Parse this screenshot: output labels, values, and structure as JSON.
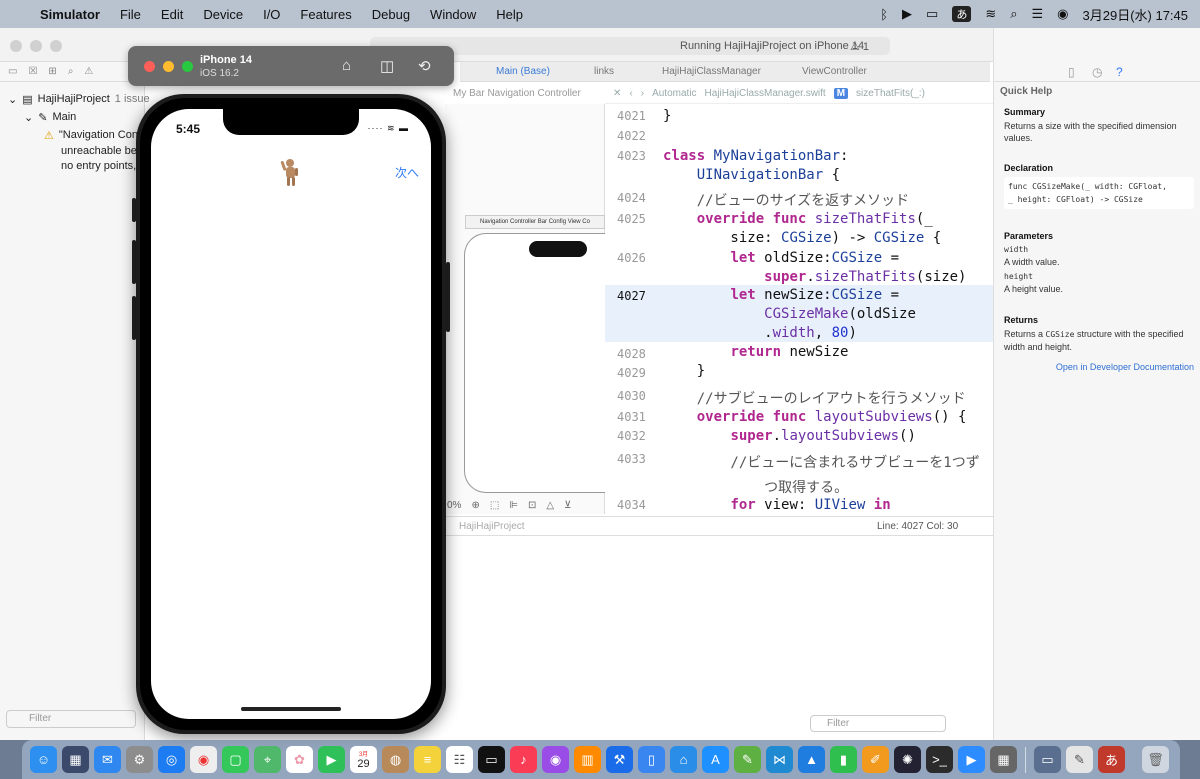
{
  "menubar": {
    "app": "Simulator",
    "items": [
      "File",
      "Edit",
      "Device",
      "I/O",
      "Features",
      "Debug",
      "Window",
      "Help"
    ],
    "ime": "あ",
    "datetime": "3月29日(水) 17:45"
  },
  "xcode": {
    "project_tab": "HajiHajiProject",
    "run_status": "Running HajiHajiProject on iPhone 14",
    "issue_count": "1",
    "navigator": {
      "project": "HajiHajiProject",
      "issue_label": "1 issue",
      "group": "Main",
      "issue_lines": [
        "\"Navigation Con",
        "unreachable bec",
        "no entry points,"
      ],
      "filter_placeholder": "Filter"
    },
    "editor_tabs": [
      "Main (Base)",
      "links",
      "HajiHajiClassManager",
      "ViewController"
    ],
    "storyboard_breadcrumb": "My Bar Navigation Controller",
    "jumpbar": {
      "mode": "Automatic",
      "file": "HajiHajiClassManager.swift",
      "symbol_badge": "M",
      "symbol": "sizeThatFits(_:)"
    },
    "scene_title": "Navigation Controller Bar Config View Co",
    "zoom": "0%",
    "status": {
      "project": "HajiHajiProject",
      "position": "Line: 4027  Col: 30"
    },
    "debug_filter_placeholder": "Filter"
  },
  "code_lines": [
    {
      "num": "4021",
      "text": "}"
    },
    {
      "num": "4022",
      "text": ""
    },
    {
      "num": "4023",
      "text": "class MyNavigationBar:"
    },
    {
      "num": "",
      "text": "    UINavigationBar {"
    },
    {
      "num": "4024",
      "text": "    //ビューのサイズを返すメソッド"
    },
    {
      "num": "4025",
      "text": "    override func sizeThatFits(_"
    },
    {
      "num": "",
      "text": "        size: CGSize) -> CGSize {"
    },
    {
      "num": "4026",
      "text": "        let oldSize:CGSize ="
    },
    {
      "num": "",
      "text": "            super.sizeThatFits(size)"
    },
    {
      "num": "4027",
      "text": "        let newSize:CGSize ="
    },
    {
      "num": "",
      "text": "            CGSizeMake(oldSize"
    },
    {
      "num": "",
      "text": "            .width, 80)"
    },
    {
      "num": "4028",
      "text": "        return newSize"
    },
    {
      "num": "4029",
      "text": "    }"
    },
    {
      "num": "4030",
      "text": "    //サブビューのレイアウトを行うメソッド"
    },
    {
      "num": "4031",
      "text": "    override func layoutSubviews() {"
    },
    {
      "num": "4032",
      "text": "        super.layoutSubviews()"
    },
    {
      "num": "4033",
      "text": "        //ビューに含まれるサブビューを1つず"
    },
    {
      "num": "",
      "text": "            つ取得する。"
    },
    {
      "num": "4034",
      "text": "        for view: UIView in"
    }
  ],
  "quick_help": {
    "title": "Quick Help",
    "summary_h": "Summary",
    "summary": "Returns a size with the specified dimension values.",
    "declaration_h": "Declaration",
    "declaration_1": "func CGSizeMake(_ width: CGFloat,",
    "declaration_2": "_ height: CGFloat) -> CGSize",
    "parameters_h": "Parameters",
    "param_width": "width",
    "param_width_desc": "A width value.",
    "param_height": "height",
    "param_height_desc": "A height value.",
    "returns_h": "Returns",
    "returns_pre": "Returns a ",
    "returns_type": "CGSize",
    "returns_post": " structure with the specified width and height.",
    "link": "Open in Developer Documentation"
  },
  "simulator": {
    "device": "iPhone 14",
    "os": "iOS 16.2",
    "time": "5:45",
    "nav_button": "次へ"
  },
  "dock": {
    "calendar_day": "29",
    "calendar_month": "3月"
  },
  "colors": {
    "accent": "#2f7bf5",
    "keyword": "#b0278f",
    "type": "#1b3f99",
    "current_line": "#e8f0fb"
  }
}
